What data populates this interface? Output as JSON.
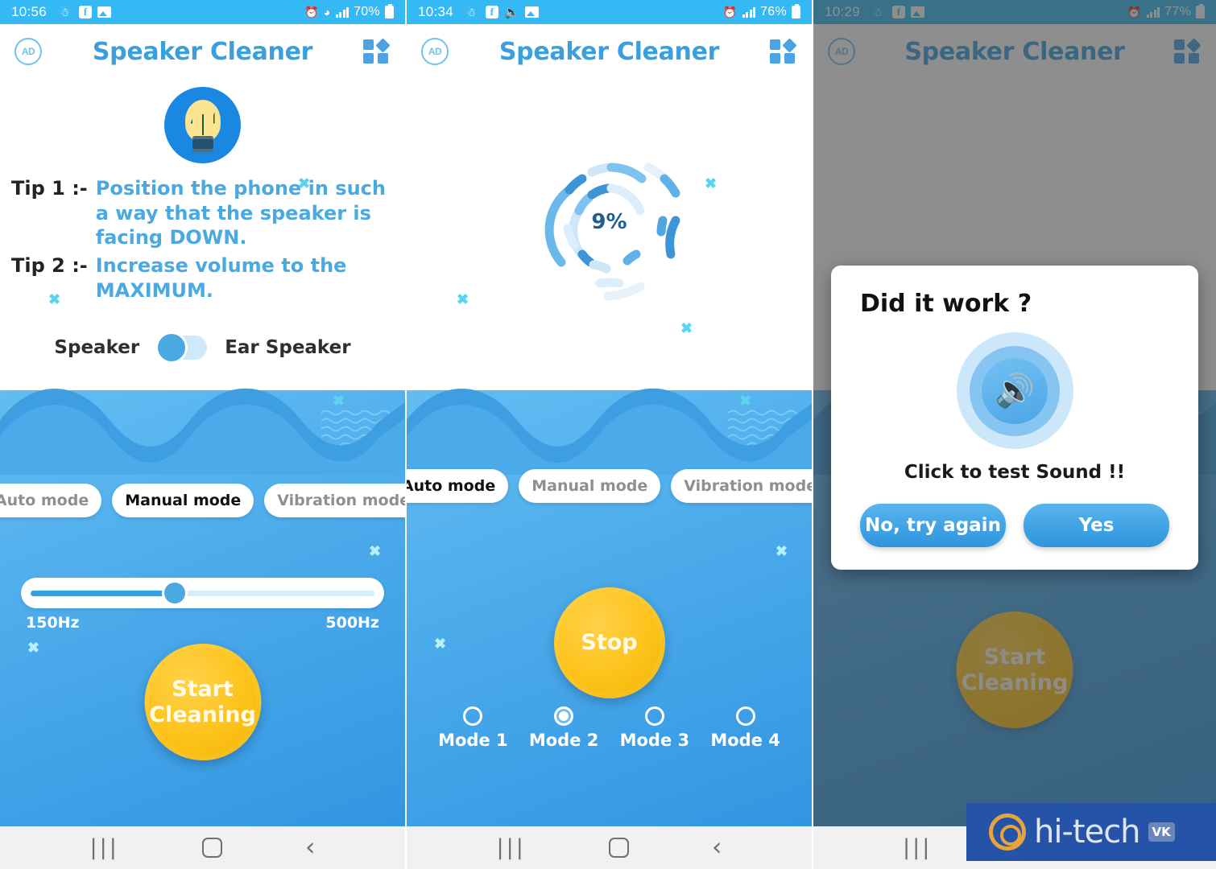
{
  "app": {
    "title": "Speaker Cleaner"
  },
  "panels": [
    {
      "id": "panel-manual-mode",
      "status": {
        "time": "10:56",
        "battery": "70%",
        "icons": [
          "snapchat-icon",
          "facebook-icon",
          "gallery-icon"
        ],
        "right_icons": [
          "alarm-icon",
          "wifi-icon",
          "signal-icon",
          "battery-icon"
        ]
      },
      "tips": [
        {
          "label": "Tip 1 :-",
          "text": "Position the phone in such a way that the speaker is facing DOWN."
        },
        {
          "label": "Tip 2 :-",
          "text": "Increase volume to the MAXIMUM."
        }
      ],
      "toggle": {
        "left_label": "Speaker",
        "right_label": "Ear Speaker",
        "state": "left"
      },
      "modes": [
        {
          "label": "Auto mode",
          "active": false
        },
        {
          "label": "Manual mode",
          "active": true
        },
        {
          "label": "Vibration mode",
          "active": false
        }
      ],
      "slider": {
        "min_label": "150Hz",
        "max_label": "500Hz",
        "percent": 42
      },
      "action_button": "Start\nCleaning"
    },
    {
      "id": "panel-auto-cleaning",
      "status": {
        "time": "10:34",
        "battery": "76%",
        "icons": [
          "snapchat-icon",
          "facebook-icon",
          "volume-icon",
          "gallery-icon"
        ],
        "right_icons": [
          "alarm-icon",
          "signal-icon",
          "battery-icon"
        ]
      },
      "progress": {
        "value": "9%"
      },
      "modes": [
        {
          "label": "Auto mode",
          "active": true
        },
        {
          "label": "Manual mode",
          "active": false
        },
        {
          "label": "Vibration mode",
          "active": false
        }
      ],
      "action_button": "Stop",
      "radio_modes": [
        {
          "label": "Mode 1",
          "selected": false
        },
        {
          "label": "Mode 2",
          "selected": true
        },
        {
          "label": "Mode 3",
          "selected": false
        },
        {
          "label": "Mode 4",
          "selected": false
        }
      ]
    },
    {
      "id": "panel-did-it-work-dialog",
      "status": {
        "time": "10:29",
        "battery": "77%",
        "icons": [
          "snapchat-icon",
          "facebook-icon",
          "gallery-icon"
        ],
        "right_icons": [
          "alarm-icon",
          "signal-icon",
          "battery-icon"
        ]
      },
      "dialog": {
        "title": "Did it work ?",
        "speaker_icon": "speaker-volume-icon",
        "subtitle": "Click to test Sound !!",
        "buttons": [
          {
            "label": "No, try again"
          },
          {
            "label": "Yes"
          }
        ]
      },
      "action_button": "Start\nCleaning"
    }
  ],
  "navbar": {
    "recents": "|||",
    "home": "home-icon",
    "back": "‹"
  },
  "watermark": {
    "text": "hi-tech",
    "badge": "VK"
  },
  "colors": {
    "accent_blue": "#35b9f4",
    "title_blue": "#3a9fdb",
    "tip_blue": "#4aa9e0",
    "yellow_button": "#fdc219",
    "dialog_button": "#3a9fe0"
  }
}
